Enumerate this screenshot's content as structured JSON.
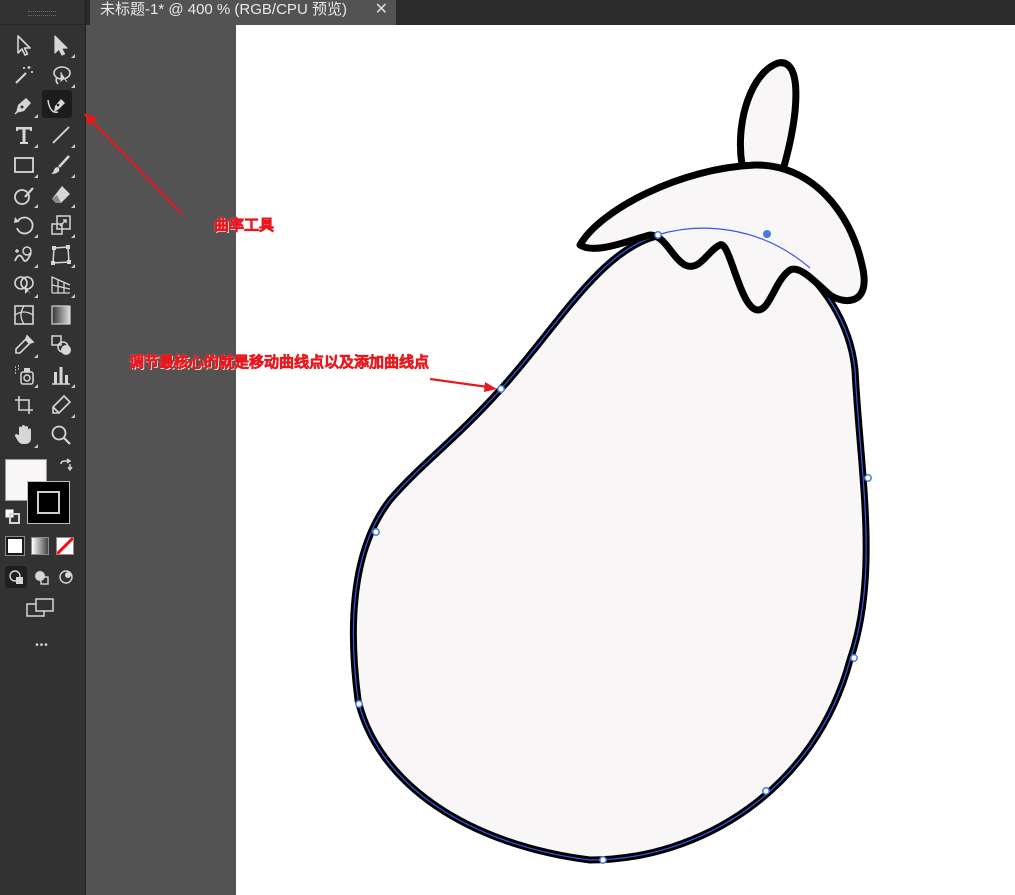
{
  "document": {
    "tab_title": "未标题-1* @ 400 % (RGB/CPU 预览)",
    "close_symbol": "✕"
  },
  "toolbar": {
    "more_label": "•••",
    "tools": [
      {
        "name": "selection-tool-icon"
      },
      {
        "name": "direct-selection-tool-icon"
      },
      {
        "name": "magic-wand-tool-icon"
      },
      {
        "name": "lasso-tool-icon"
      },
      {
        "name": "pen-tool-icon"
      },
      {
        "name": "curvature-tool-icon",
        "active": true
      },
      {
        "name": "type-tool-icon"
      },
      {
        "name": "line-segment-tool-icon"
      },
      {
        "name": "rectangle-tool-icon"
      },
      {
        "name": "paintbrush-tool-icon"
      },
      {
        "name": "shaper-tool-icon"
      },
      {
        "name": "eraser-tool-icon"
      },
      {
        "name": "rotate-tool-icon"
      },
      {
        "name": "scale-tool-icon"
      },
      {
        "name": "warp-tool-icon"
      },
      {
        "name": "free-transform-tool-icon"
      },
      {
        "name": "shape-builder-tool-icon"
      },
      {
        "name": "perspective-grid-tool-icon"
      },
      {
        "name": "mesh-tool-icon"
      },
      {
        "name": "gradient-tool-icon"
      },
      {
        "name": "eyedropper-tool-icon"
      },
      {
        "name": "blend-tool-icon"
      },
      {
        "name": "symbol-sprayer-tool-icon"
      },
      {
        "name": "column-graph-tool-icon"
      },
      {
        "name": "artboard-tool-icon"
      },
      {
        "name": "slice-tool-icon"
      },
      {
        "name": "hand-tool-icon"
      },
      {
        "name": "zoom-tool-icon"
      }
    ],
    "fill_color": "#f8f6f7",
    "stroke_color": "#000000"
  },
  "annotations": {
    "curvature_label": "曲率工具",
    "core_tip": "调节最核心的就是移动曲线点以及添加曲线点",
    "color": "#e8191e"
  },
  "artwork": {
    "fill": "#f8f6f7",
    "stroke": "#000000",
    "path_highlight": "#3c55e6",
    "anchor_color": "#4a7bdc"
  }
}
